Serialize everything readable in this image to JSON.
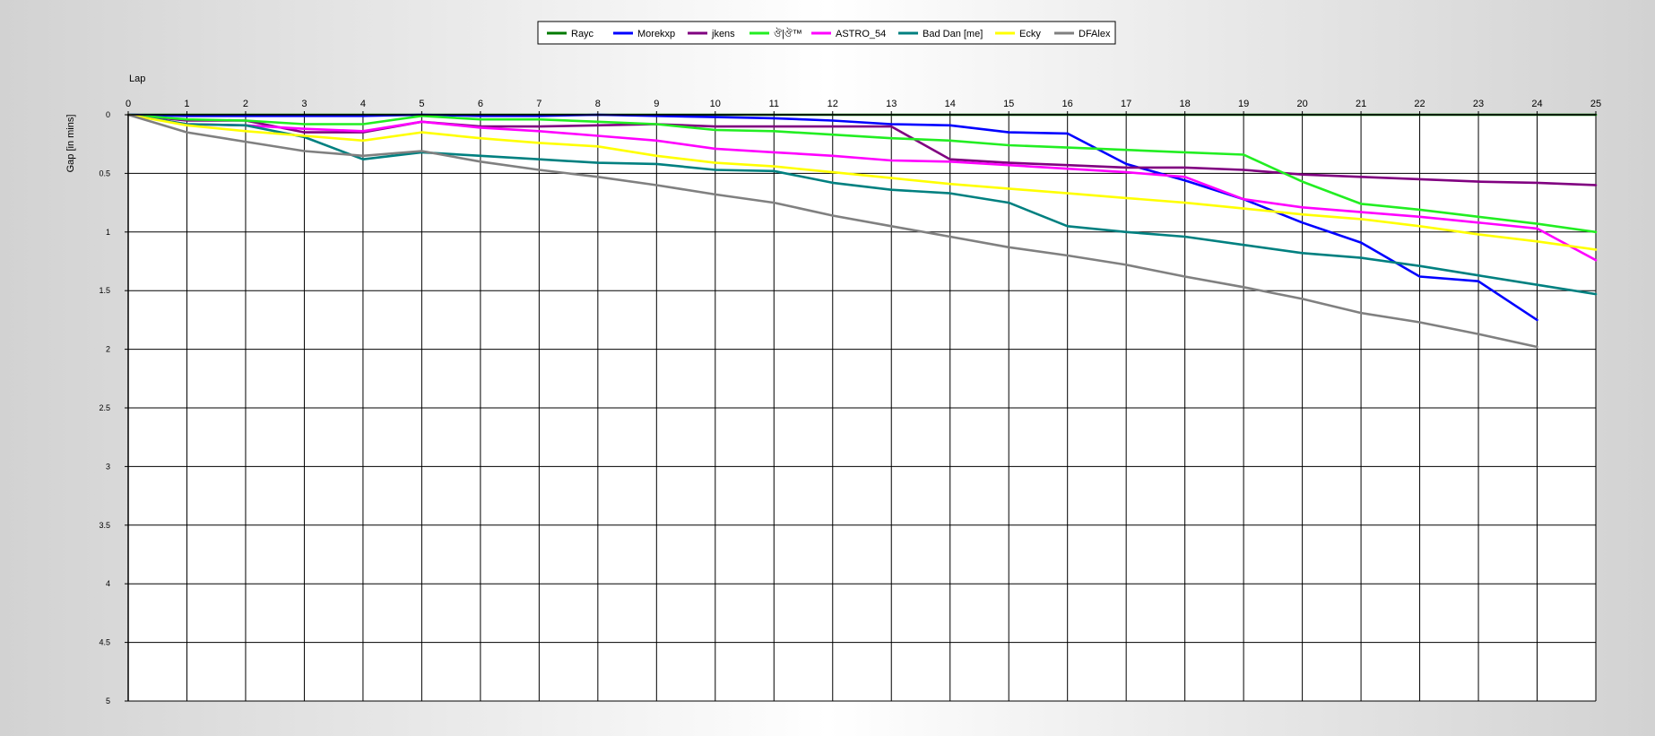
{
  "chart_data": {
    "type": "line",
    "xlabel": "Lap",
    "ylabel": "Gap [in mins]",
    "x": [
      0,
      1,
      2,
      3,
      4,
      5,
      6,
      7,
      8,
      9,
      10,
      11,
      12,
      13,
      14,
      15,
      16,
      17,
      18,
      19,
      20,
      21,
      22,
      23,
      24,
      25
    ],
    "xlim": [
      0,
      25
    ],
    "ylim": [
      0,
      5
    ],
    "y_inverted": true,
    "xticks": [
      "0",
      "1",
      "2",
      "3",
      "4",
      "5",
      "6",
      "7",
      "8",
      "9",
      "10",
      "11",
      "12",
      "13",
      "14",
      "15",
      "16",
      "17",
      "18",
      "19",
      "20",
      "21",
      "22",
      "23",
      "24",
      "25"
    ],
    "yticks": [
      "0",
      "0.5",
      "1",
      "1.5",
      "2",
      "2.5",
      "3",
      "3.5",
      "4",
      "4.5",
      "5"
    ],
    "grid": true,
    "legend_position": "top-center",
    "series": [
      {
        "name": "Rayc",
        "color": "#007a00",
        "values": [
          0,
          0,
          0,
          0,
          0,
          0,
          0,
          0,
          0,
          0,
          0,
          0,
          0,
          0,
          0,
          0,
          0,
          0,
          0,
          0,
          0,
          0,
          0,
          0,
          0,
          0
        ]
      },
      {
        "name": "Morekxp",
        "color": "#0000ff",
        "values": [
          0,
          0.01,
          0.01,
          0.01,
          0.01,
          0.0,
          0.01,
          0.01,
          0.0,
          0.01,
          0.02,
          0.03,
          0.05,
          0.08,
          0.09,
          0.15,
          0.16,
          0.42,
          0.56,
          0.72,
          0.92,
          1.09,
          1.38,
          1.42,
          1.75,
          null
        ]
      },
      {
        "name": "jkens",
        "color": "#800080",
        "values": [
          0,
          0.05,
          0.05,
          0.15,
          0.15,
          0.06,
          0.1,
          0.1,
          0.09,
          0.08,
          0.1,
          0.1,
          0.1,
          0.1,
          0.38,
          0.41,
          0.43,
          0.45,
          0.45,
          0.47,
          0.51,
          0.53,
          0.55,
          0.57,
          0.58,
          0.6
        ]
      },
      {
        "name": "ঔ|ঔ™",
        "color": "#22ee22",
        "values": [
          0,
          0.04,
          0.05,
          0.08,
          0.08,
          0.01,
          0.04,
          0.04,
          0.06,
          0.08,
          0.13,
          0.14,
          0.17,
          0.2,
          0.22,
          0.26,
          0.28,
          0.3,
          0.32,
          0.34,
          0.57,
          0.76,
          0.81,
          0.87,
          0.93,
          1.0
        ]
      },
      {
        "name": "ASTRO_54",
        "color": "#ff00ff",
        "values": [
          0,
          0.08,
          0.09,
          0.12,
          0.14,
          0.06,
          0.11,
          0.14,
          0.18,
          0.22,
          0.29,
          0.32,
          0.35,
          0.39,
          0.4,
          0.43,
          0.46,
          0.49,
          0.53,
          0.72,
          0.79,
          0.83,
          0.87,
          0.92,
          0.97,
          1.24
        ]
      },
      {
        "name": "Bad Dan [me]",
        "color": "#008080",
        "values": [
          0,
          0.08,
          0.09,
          0.19,
          0.38,
          0.32,
          0.35,
          0.38,
          0.41,
          0.42,
          0.47,
          0.48,
          0.58,
          0.64,
          0.67,
          0.75,
          0.95,
          1.0,
          1.04,
          1.11,
          1.18,
          1.22,
          1.29,
          1.37,
          1.45,
          1.53
        ]
      },
      {
        "name": "Ecky",
        "color": "#ffff00",
        "values": [
          0,
          0.09,
          0.14,
          0.18,
          0.22,
          0.15,
          0.2,
          0.24,
          0.27,
          0.35,
          0.41,
          0.44,
          0.49,
          0.54,
          0.59,
          0.63,
          0.67,
          0.71,
          0.75,
          0.8,
          0.85,
          0.89,
          0.95,
          1.02,
          1.08,
          1.15
        ]
      },
      {
        "name": "DFAlex",
        "color": "#808080",
        "values": [
          0,
          0.15,
          0.23,
          0.31,
          0.35,
          0.31,
          0.4,
          0.47,
          0.53,
          0.6,
          0.68,
          0.75,
          0.86,
          0.95,
          1.04,
          1.13,
          1.2,
          1.28,
          1.38,
          1.47,
          1.57,
          1.69,
          1.77,
          1.87,
          1.98,
          null
        ]
      }
    ]
  }
}
